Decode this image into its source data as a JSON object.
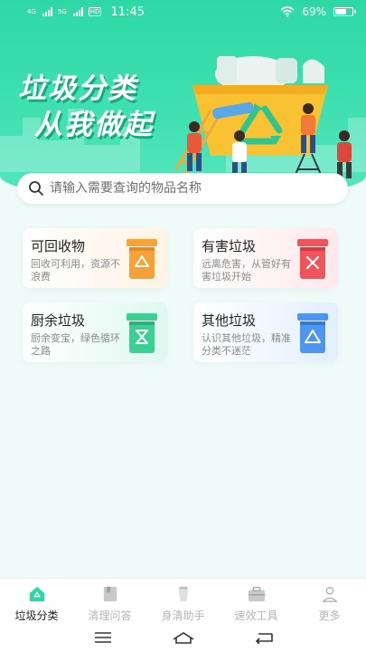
{
  "status_bar": {
    "net1": "4G",
    "net2": "5G",
    "hd": "HD",
    "time": "11:45",
    "battery_text": "69%",
    "battery_level": 0.69
  },
  "hero": {
    "title_line1": "垃圾分类",
    "title_line2": "从我做起"
  },
  "search": {
    "placeholder": "请输入需要查询的物品名称",
    "value": ""
  },
  "categories": [
    {
      "name": "可回收物",
      "desc": "回收可利用，资源不浪费",
      "color": "#f7a237",
      "icon": "recycle-icon"
    },
    {
      "name": "有害垃圾",
      "desc": "远离危害，从管好有害垃圾开始",
      "color": "#f0545a",
      "icon": "hazard-x-icon"
    },
    {
      "name": "厨余垃圾",
      "desc": "厨余变宝，绿色循环之路",
      "color": "#3ccf93",
      "icon": "hourglass-icon"
    },
    {
      "name": "其他垃圾",
      "desc": "认识其他垃圾，精准分类不迷茫",
      "color": "#4c96f0",
      "icon": "triangle-icon"
    }
  ],
  "nav": [
    {
      "label": "垃圾分类",
      "icon": "home-icon",
      "active": true
    },
    {
      "label": "清理问答",
      "icon": "book-icon",
      "active": false
    },
    {
      "label": "身清助手",
      "icon": "cup-icon",
      "active": false
    },
    {
      "label": "速效工具",
      "icon": "toolbox-icon",
      "active": false
    },
    {
      "label": "更多",
      "icon": "person-icon",
      "active": false
    }
  ],
  "colors": {
    "accent": "#2ed8a4",
    "background": "#eefbf8"
  }
}
